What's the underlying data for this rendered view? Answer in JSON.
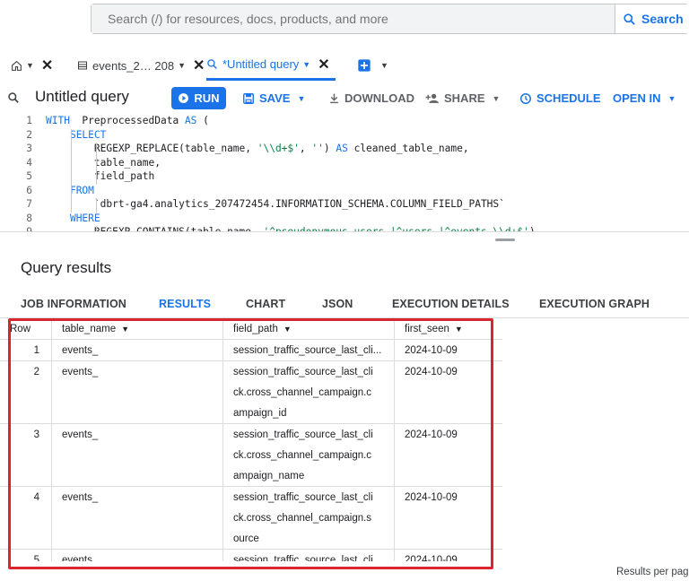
{
  "search": {
    "placeholder": "Search (/) for resources, docs, products, and more",
    "button_label": "Search"
  },
  "tabs": [
    {
      "label": "events_2… 208"
    },
    {
      "label": "*Untitled query"
    }
  ],
  "query": {
    "title": "Untitled query",
    "run_label": "RUN",
    "save_label": "SAVE",
    "download_label": "DOWNLOAD",
    "share_label": "SHARE",
    "schedule_label": "SCHEDULE",
    "open_in_label": "OPEN IN"
  },
  "code_lines": [
    {
      "n": "1",
      "parts": [
        [
          "kw",
          "WITH"
        ],
        [
          "",
          "  PreprocessedData "
        ],
        [
          "kw",
          "AS"
        ],
        [
          "",
          " ("
        ]
      ]
    },
    {
      "n": "2",
      "parts": [
        [
          "",
          "    "
        ],
        [
          "kw",
          "SELECT"
        ]
      ]
    },
    {
      "n": "3",
      "parts": [
        [
          "",
          "        REGEXP_REPLACE(table_name, "
        ],
        [
          "str",
          "'\\\\d+$'"
        ],
        [
          "",
          ", "
        ],
        [
          "str",
          "''"
        ],
        [
          "",
          ") "
        ],
        [
          "kw",
          "AS"
        ],
        [
          "",
          " cleaned_table_name,"
        ]
      ]
    },
    {
      "n": "4",
      "parts": [
        [
          "",
          "        table_name,"
        ]
      ]
    },
    {
      "n": "5",
      "parts": [
        [
          "",
          "        field_path"
        ]
      ]
    },
    {
      "n": "6",
      "parts": [
        [
          "",
          "    "
        ],
        [
          "kw",
          "FROM"
        ]
      ]
    },
    {
      "n": "7",
      "parts": [
        [
          "",
          "        `dbrt-ga4.analytics_207472454.INFORMATION_SCHEMA.COLUMN_FIELD_PATHS`"
        ]
      ]
    },
    {
      "n": "8",
      "parts": [
        [
          "",
          "    "
        ],
        [
          "kw",
          "WHERE"
        ]
      ]
    },
    {
      "n": "9",
      "parts": [
        [
          "",
          "        REGEXP_CONTAINS(table_name, "
        ],
        [
          "str",
          "'^pseudonymous_users_|^users_|^events_\\\\d+$'"
        ],
        [
          "",
          ")"
        ]
      ]
    }
  ],
  "results": {
    "title": "Query results",
    "tabs": [
      "JOB INFORMATION",
      "RESULTS",
      "CHART",
      "JSON",
      "EXECUTION DETAILS",
      "EXECUTION GRAPH"
    ],
    "columns": [
      "Row",
      "table_name",
      "field_path",
      "first_seen"
    ],
    "rows": [
      {
        "row": "1",
        "table_name": "events_",
        "field_path": [
          "session_traffic_source_last_cli..."
        ],
        "first_seen": "2024-10-09"
      },
      {
        "row": "2",
        "table_name": "events_",
        "field_path": [
          "session_traffic_source_last_cli",
          "ck.cross_channel_campaign.c",
          "ampaign_id"
        ],
        "first_seen": "2024-10-09"
      },
      {
        "row": "3",
        "table_name": "events_",
        "field_path": [
          "session_traffic_source_last_cli",
          "ck.cross_channel_campaign.c",
          "ampaign_name"
        ],
        "first_seen": "2024-10-09"
      },
      {
        "row": "4",
        "table_name": "events_",
        "field_path": [
          "session_traffic_source_last_cli",
          "ck.cross_channel_campaign.s",
          "ource"
        ],
        "first_seen": "2024-10-09"
      },
      {
        "row": "5",
        "table_name": "events_",
        "field_path": [
          "session_traffic_source_last_cli"
        ],
        "first_seen": "2024-10-09"
      }
    ],
    "per_page_label": "Results per pag"
  },
  "colors": {
    "accent": "#1a73e8",
    "highlight": "#d9262e"
  }
}
